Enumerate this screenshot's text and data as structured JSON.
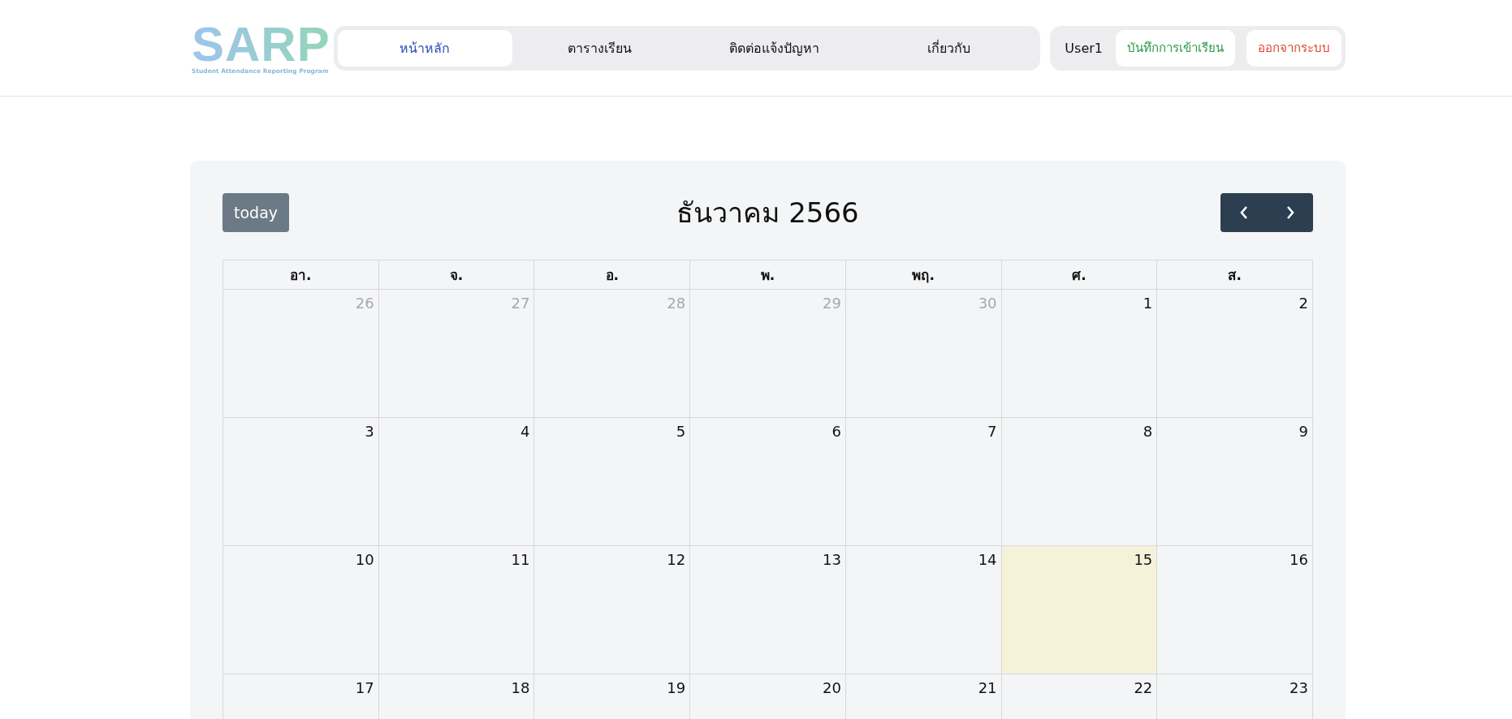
{
  "logo": {
    "title": "SARP",
    "subtitle": "Student Attendance Reporting Program"
  },
  "nav": [
    {
      "label": "หน้าหลัก",
      "selected": true
    },
    {
      "label": "ตารางเรียน",
      "selected": false
    },
    {
      "label": "ติดต่อแจ้งปัญหา",
      "selected": false
    },
    {
      "label": "เกี่ยวกับ",
      "selected": false
    }
  ],
  "user": {
    "name": "User1",
    "actions": [
      {
        "label": "บันทึกการเข้าเรียน",
        "kind": "record"
      },
      {
        "label": "ออกจากระบบ",
        "kind": "logout"
      }
    ]
  },
  "calendar": {
    "today_button": "today",
    "title": "ธันวาคม 2566",
    "weekdays": [
      "อา.",
      "จ.",
      "อ.",
      "พ.",
      "พฤ.",
      "ศ.",
      "ส."
    ],
    "weeks": [
      [
        {
          "day": "26",
          "other_month": true,
          "today": false
        },
        {
          "day": "27",
          "other_month": true,
          "today": false
        },
        {
          "day": "28",
          "other_month": true,
          "today": false
        },
        {
          "day": "29",
          "other_month": true,
          "today": false
        },
        {
          "day": "30",
          "other_month": true,
          "today": false
        },
        {
          "day": "1",
          "other_month": false,
          "today": false
        },
        {
          "day": "2",
          "other_month": false,
          "today": false
        }
      ],
      [
        {
          "day": "3",
          "other_month": false,
          "today": false
        },
        {
          "day": "4",
          "other_month": false,
          "today": false
        },
        {
          "day": "5",
          "other_month": false,
          "today": false
        },
        {
          "day": "6",
          "other_month": false,
          "today": false
        },
        {
          "day": "7",
          "other_month": false,
          "today": false
        },
        {
          "day": "8",
          "other_month": false,
          "today": false
        },
        {
          "day": "9",
          "other_month": false,
          "today": false
        }
      ],
      [
        {
          "day": "10",
          "other_month": false,
          "today": false
        },
        {
          "day": "11",
          "other_month": false,
          "today": false
        },
        {
          "day": "12",
          "other_month": false,
          "today": false
        },
        {
          "day": "13",
          "other_month": false,
          "today": false
        },
        {
          "day": "14",
          "other_month": false,
          "today": false
        },
        {
          "day": "15",
          "other_month": false,
          "today": true
        },
        {
          "day": "16",
          "other_month": false,
          "today": false
        }
      ],
      [
        {
          "day": "17",
          "other_month": false,
          "today": false
        },
        {
          "day": "18",
          "other_month": false,
          "today": false
        },
        {
          "day": "19",
          "other_month": false,
          "today": false
        },
        {
          "day": "20",
          "other_month": false,
          "today": false
        },
        {
          "day": "21",
          "other_month": false,
          "today": false
        },
        {
          "day": "22",
          "other_month": false,
          "today": false
        },
        {
          "day": "23",
          "other_month": false,
          "today": false
        }
      ]
    ]
  }
}
